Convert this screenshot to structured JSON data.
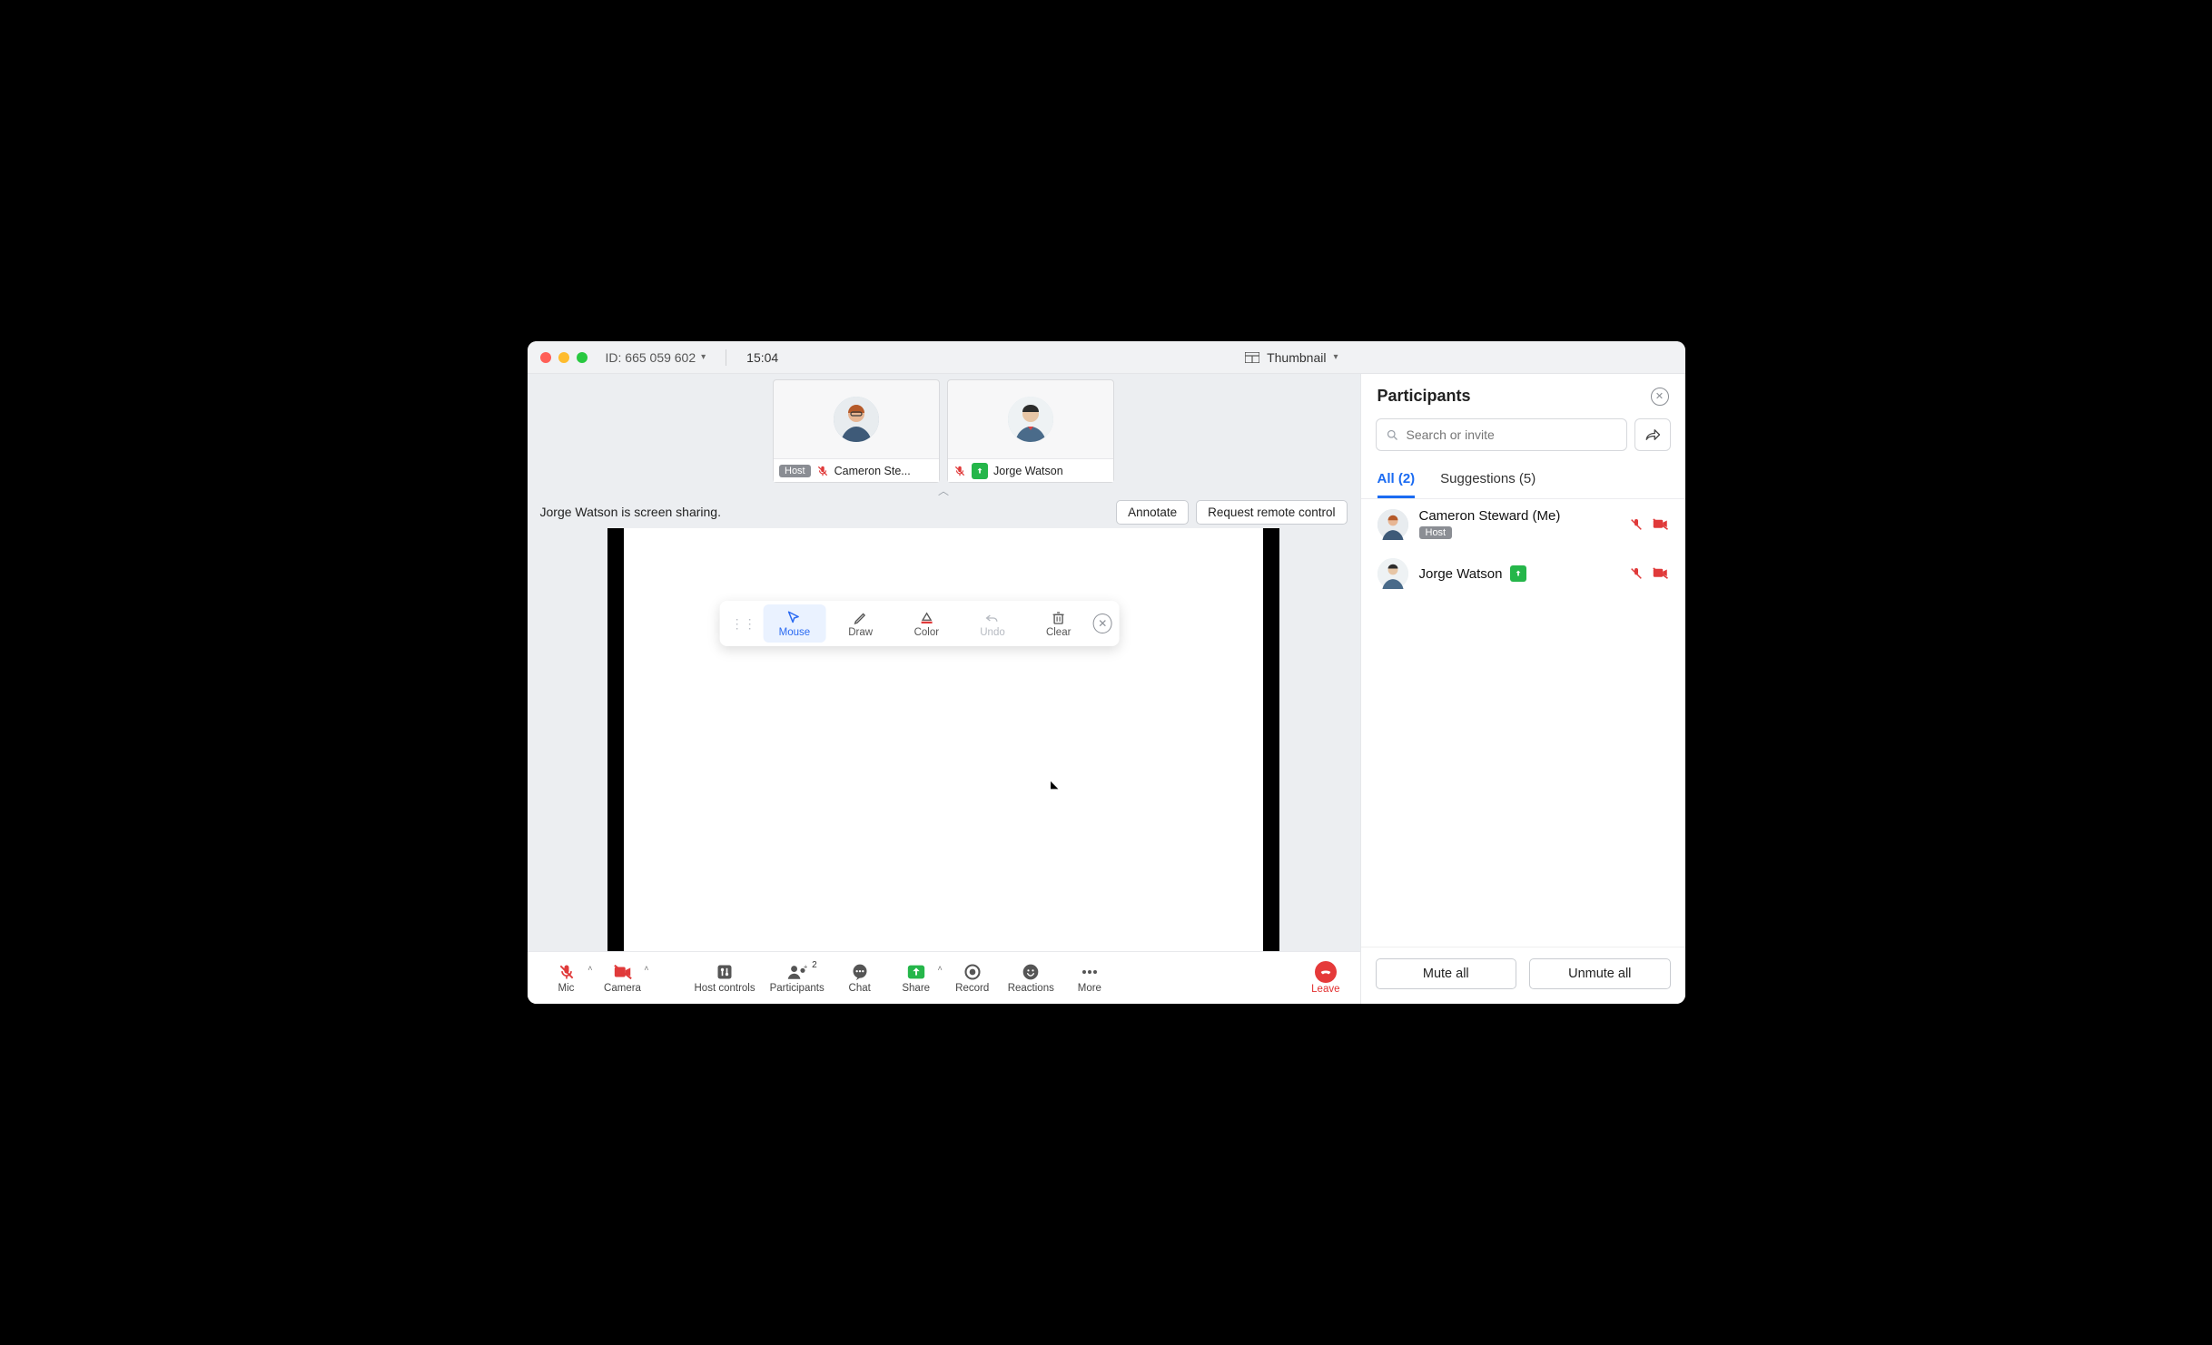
{
  "titlebar": {
    "meeting_id_label": "ID: 665 059 602",
    "time": "15:04",
    "view_toggle_label": "Thumbnail"
  },
  "thumbnails": [
    {
      "host_badge": "Host",
      "mic_muted": true,
      "name": "Cameron Ste..."
    },
    {
      "sharing": true,
      "mic_muted": true,
      "name": "Jorge Watson"
    }
  ],
  "share_status": "Jorge Watson is screen sharing.",
  "share_actions": {
    "annotate": "Annotate",
    "request_remote": "Request remote control"
  },
  "annotation_toolbar": {
    "mouse": "Mouse",
    "draw": "Draw",
    "color": "Color",
    "undo": "Undo",
    "clear": "Clear"
  },
  "controls": {
    "mic": "Mic",
    "camera": "Camera",
    "host_controls": "Host controls",
    "participants": "Participants",
    "participants_count": "2",
    "chat": "Chat",
    "share": "Share",
    "record": "Record",
    "reactions": "Reactions",
    "more": "More",
    "leave": "Leave"
  },
  "panel": {
    "title": "Participants",
    "search_placeholder": "Search or invite",
    "tabs": {
      "all": "All (2)",
      "suggestions": "Suggestions (5)"
    },
    "rows": [
      {
        "name": "Cameron Steward (Me)",
        "host_badge": "Host",
        "mic_muted": true,
        "cam_muted": true
      },
      {
        "name": "Jorge Watson",
        "sharing": true,
        "mic_muted": true,
        "cam_muted": true
      }
    ],
    "mute_all": "Mute all",
    "unmute_all": "Unmute all"
  },
  "colors": {
    "accent": "#1a6bf2",
    "danger": "#e03a3a",
    "share_green": "#25b64a"
  }
}
